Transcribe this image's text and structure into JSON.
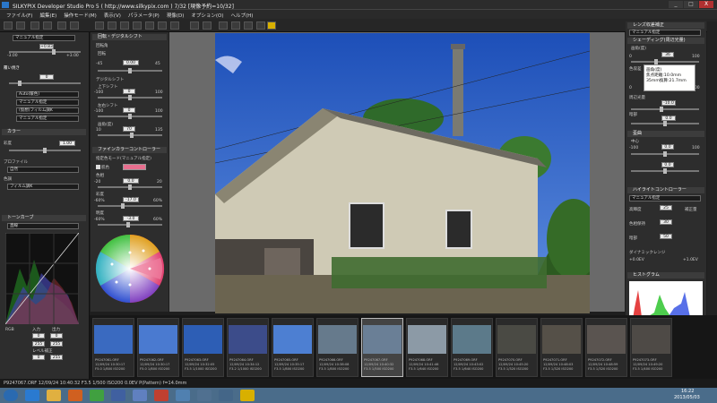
{
  "window": {
    "title": "SILKYPIX Developer Studio Pro 5 ( http://www.silkypix.com )  7/32 [現像予約=10/32]",
    "minimize": "_",
    "maximize": "□",
    "close": "X"
  },
  "menu": [
    "ファイル(F)",
    "編集(E)",
    "操作モード(M)",
    "表示(V)",
    "パラメータ(P)",
    "現像(D)",
    "オプション(O)",
    "ヘルプ(H)"
  ],
  "left": {
    "exposure_label": "マニュアル指定",
    "exposure_value": "+0.83",
    "exposure_min": "-3.00",
    "exposure_max": "+3.00",
    "highlight_label": "覆い焼き",
    "highlight_value": "0",
    "wb_auto": "Auto(暖色)",
    "wb_manual": "マニュアル指定",
    "wb_film": "(仮想)フィルム調K",
    "wb_manual2": "マニュアル指定",
    "color_label": "カラー",
    "sharp_label": "彩度",
    "sharp_value": "1.00",
    "profile_label": "プロファイル",
    "profile_value": "自然",
    "tone_label": "色調",
    "tone_value": "フィルム調K",
    "curve_label": "トーンカーブ",
    "curve_preset": "直線",
    "rgb_label": "RGB",
    "input_label": "入力",
    "output_label": "出力",
    "in0": "0",
    "in1": "255",
    "out0": "0",
    "out1": "255",
    "level_label": "レベル補正"
  },
  "mid": {
    "rotate_label": "回転・デジタルシフト",
    "rotate_mode": "回転角",
    "rotate_sub": "回転",
    "rotate_value": "0.00",
    "rot_min": "-45",
    "rot_max": "45",
    "shift_label": "デジタルシフト",
    "up_label": "上下シフト",
    "up_value": "0",
    "lr_label": "左右シフト",
    "lr_value": "0",
    "scale_label": "画角(度)",
    "scale_value": "70",
    "v_neg100": "-100",
    "v_100": "100",
    "v_10": "10",
    "v_135": "135",
    "fine_label": "ファインカラーコントローラー",
    "fine_mode": "指定色モード(マニュアル指定)",
    "hue_label": "色相",
    "hue_value": "0.0",
    "sat_label": "彩度",
    "sat_value": "-17.0",
    "bright_label": "明度",
    "bright_value": "-3.0",
    "color_check": "肌色",
    "neg20": "-20",
    "pos20": "20",
    "neg60": "-60%",
    "pos60": "60%"
  },
  "right": {
    "lens_label": "レンズ収差補正",
    "lens_mode": "マニュアル指定",
    "shading_label": "シェーディング(周辺光量)",
    "shading_sub": "画角(度)",
    "shading_value": "36",
    "tooltip_title": "画角(度)",
    "tooltip_line1": "焦点距離:10.0mm",
    "tooltip_line2": "35mm換算:21.7mm",
    "ca_value": "-10.0",
    "ca_value2": "0.0",
    "dist_label": "歪曲",
    "dist_sub": "中心",
    "dist_value": "0.0",
    "dist_left": "-100",
    "dist_right": "100",
    "highlight_label": "ハイライトコントローラー",
    "hl_mode": "マニュアル指定",
    "hl_value1": "25",
    "hl_value2": "30",
    "hl_value3": "50",
    "dyn_label": "ダイナミックレンジ",
    "dyn_value1": "+0.0EV",
    "dyn_value2": "+1.0EV",
    "histo_label": "ヒストグラム",
    "shading_0": "0",
    "shading_100": "100",
    "ac_label": "色収差",
    "ac_200": "200",
    "r_label": "周辺光量",
    "shadow_label": "暗部",
    "hl_lbl1": "高輝度",
    "hl_lbl2": "補正量",
    "hl_lbl3": "色相保持",
    "dark_label": "暗部"
  },
  "film": [
    {
      "name": "P9247061.ORF",
      "date": "12/09/24 10:30:17",
      "exp": "F5.0 1/800 ISO200"
    },
    {
      "name": "P9247062.ORF",
      "date": "12/09/24 10:30:17",
      "exp": "F5.0 1/800 ISO200"
    },
    {
      "name": "P9247063.ORF",
      "date": "12/09/24 10:32:05",
      "exp": "F3.5 1/1000 ISO200"
    },
    {
      "name": "P9247064.ORF",
      "date": "12/09/24 10:34:12",
      "exp": "F3.2 1/1000 ISO200"
    },
    {
      "name": "P9247065.ORF",
      "date": "12/09/24 10:35:17",
      "exp": "F3.5 1/800 ISO200"
    },
    {
      "name": "P9247066.ORF",
      "date": "12/09/24 10:38:08",
      "exp": "F3.5 1/800 ISO200"
    },
    {
      "name": "P9247067.ORF",
      "date": "12/09/24 10:40:32",
      "exp": "F3.5 1/500 ISO200"
    },
    {
      "name": "P9247068.ORF",
      "date": "12/09/24 10:41:46",
      "exp": "F3.5 1/640 ISO200"
    },
    {
      "name": "P9247069.ORF",
      "date": "12/09/24 10:43:02",
      "exp": "F3.5 1/640 ISO200"
    },
    {
      "name": "P9247070.ORF",
      "date": "12/09/24 10:45:20",
      "exp": "F3.5 1/320 ISO200"
    },
    {
      "name": "P9247071.ORF",
      "date": "12/09/24 10:48:03",
      "exp": "F3.5 1/320 ISO200"
    },
    {
      "name": "P9247072.ORF",
      "date": "12/09/24 10:48:59",
      "exp": "F3.5 1/320 ISO200"
    },
    {
      "name": "P9247073.ORF",
      "date": "12/09/24 10:49:20",
      "exp": "F3.5 1/400 ISO200"
    }
  ],
  "status": "P9247067.ORF  12/09/24 10:40:32  F3.5  1/500  ISO200  0.0EV  P(Pattern)  f=14.0mm",
  "taskbar": {
    "time": "16:22",
    "date": "2013/05/03"
  }
}
